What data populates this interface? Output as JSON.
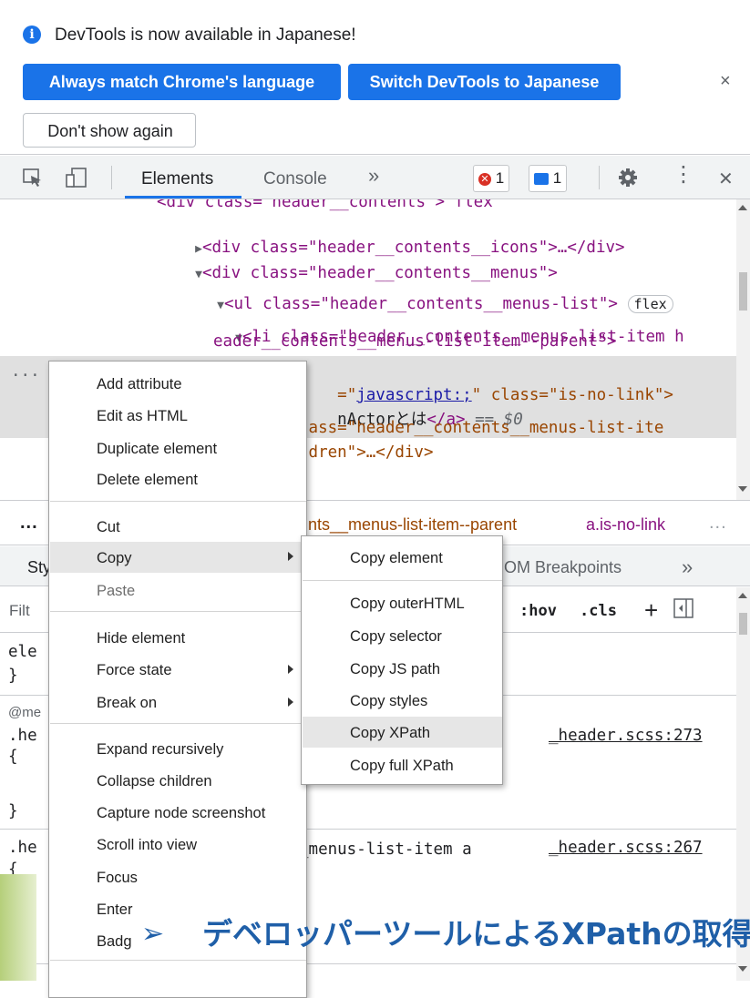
{
  "infobar": {
    "message": "DevTools is now available in Japanese!",
    "match_button": "Always match Chrome's language",
    "switch_button": "Switch DevTools to Japanese",
    "dont_show_button": "Don't show again",
    "close": "×"
  },
  "toolbar": {
    "tab_elements": "Elements",
    "tab_console": "Console",
    "more_tabs": "»",
    "error_count": "1",
    "message_count": "1",
    "kebab": "⋮",
    "close": "✕",
    "accent_color": "#1a73e8"
  },
  "dom": {
    "line0": "<div class=\"header__contents\"> flex",
    "line1_tag": "<div class=\"header__contents__icons\">…</div>",
    "line2_tag": "<div class=\"header__contents__menus\">",
    "line3_tag": "<ul class=\"header__contents__menus-list\">",
    "line3_pill": "flex",
    "line4": "<li class=\"header__contents__menus-list-item h",
    "line5": "eader__contents__menus-list-item--parent\">",
    "ellipsis": "...",
    "line6_prefix": "=\"",
    "line6_link": "javascript:;",
    "line6_rest": "\" class=\"is-no-link\">",
    "line7_text": "nActorとは",
    "line7_close": "</a>",
    "line7_eq": " == $0",
    "line8": "lass=\"header__contents__menus-list-ite",
    "line9": "ldren\">…</div>"
  },
  "breadcrumb": {
    "left_dots": "...",
    "crumb1": "nts__menus-list-item--parent",
    "crumb2": "a.is-no-link",
    "right_dots": "..."
  },
  "styles_tabs": {
    "styles_partial": "Sty",
    "dom_breakpoints": "OM Breakpoints",
    "more": "»"
  },
  "filter": {
    "placeholder_partial": "Filt",
    "hov": ":hov",
    "cls": ".cls",
    "plus": "+"
  },
  "rules": {
    "r1_sel": "ele",
    "r1_close": "}",
    "r2_media": "@me",
    "r2_sel": ".he",
    "r2_open": "{",
    "r2_src": "_header.scss:273",
    "r2_close": "}",
    "r3_sel": ".he",
    "r3_selrest": "_menus-list-item a",
    "r3_src": "_header.scss:267",
    "r3_open": "{",
    "r3_close": "}"
  },
  "context_menu": {
    "add_attribute": "Add attribute",
    "edit_html": "Edit as HTML",
    "duplicate": "Duplicate element",
    "delete": "Delete element",
    "cut": "Cut",
    "copy": "Copy",
    "paste": "Paste",
    "hide": "Hide element",
    "force_state": "Force state",
    "break_on": "Break on",
    "expand": "Expand recursively",
    "collapse": "Collapse children",
    "capture": "Capture node screenshot",
    "scroll": "Scroll into view",
    "focus": "Focus",
    "enter": "Enter",
    "badge": "Badg"
  },
  "copy_menu": {
    "copy_element": "Copy element",
    "copy_outer": "Copy outerHTML",
    "copy_selector": "Copy selector",
    "copy_js": "Copy JS path",
    "copy_styles": "Copy styles",
    "copy_xpath": "Copy XPath",
    "copy_full_xpath": "Copy full XPath"
  },
  "caption": {
    "bullet": "➢",
    "text": "デベロッパーツールによるXPathの取得"
  }
}
